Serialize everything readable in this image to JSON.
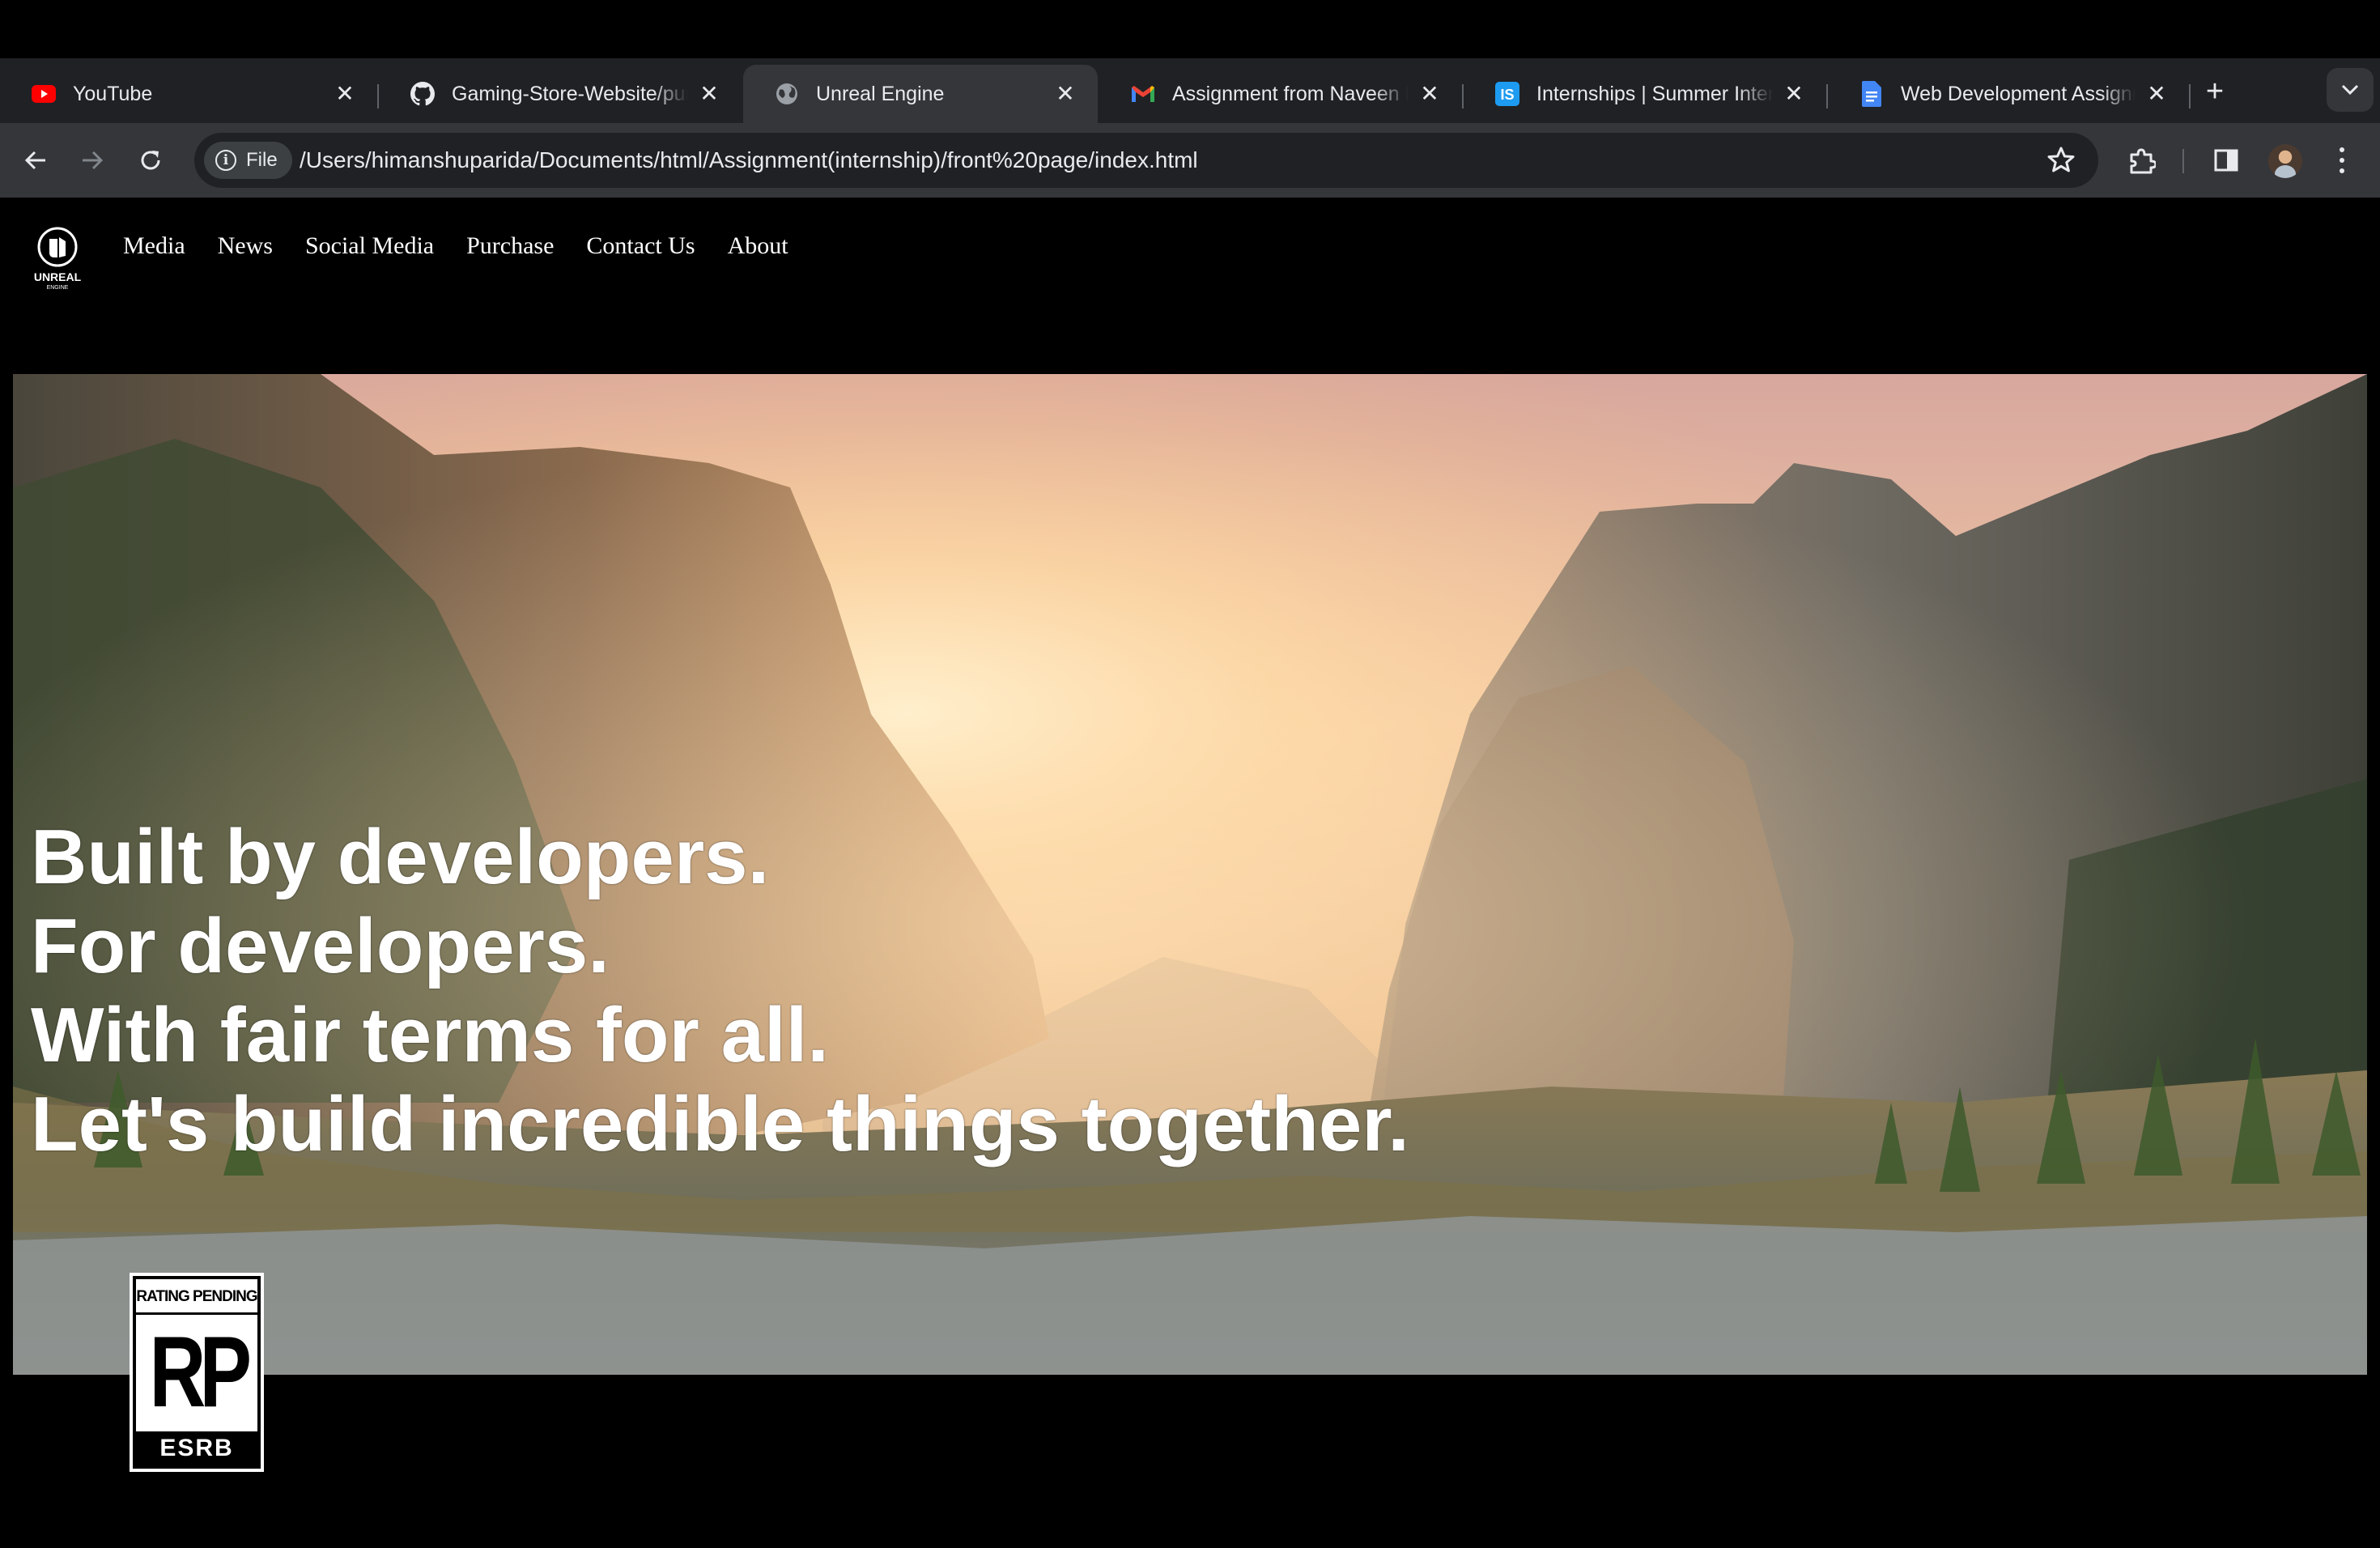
{
  "browser": {
    "tabs": [
      {
        "title": "YouTube",
        "icon": "youtube-icon",
        "active": false
      },
      {
        "title": "Gaming-Store-Website/pur",
        "icon": "github-icon",
        "active": false
      },
      {
        "title": "Unreal Engine",
        "icon": "globe-icon",
        "active": true
      },
      {
        "title": "Assignment from Naveen K",
        "icon": "gmail-icon",
        "active": false
      },
      {
        "title": "Internships | Summer Intern",
        "icon": "internshala-icon",
        "active": false
      },
      {
        "title": "Web Development Assignm",
        "icon": "google-docs-icon",
        "active": false
      }
    ],
    "address_chip": "File",
    "url": "/Users/himanshuparida/Documents/html/Assignment(internship)/front%20page/index.html"
  },
  "site": {
    "logo_text": "UNREAL",
    "logo_subtext": "ENGINE",
    "nav": [
      "Media",
      "News",
      "Social Media",
      "Purchase",
      "Contact Us",
      "About"
    ],
    "headline": [
      "Built by developers.",
      "For developers.",
      "With fair terms for all.",
      "Let's build incredible things together."
    ],
    "esrb": {
      "top": "RATING PENDING",
      "mid": "RP",
      "bottom": "ESRB"
    }
  }
}
